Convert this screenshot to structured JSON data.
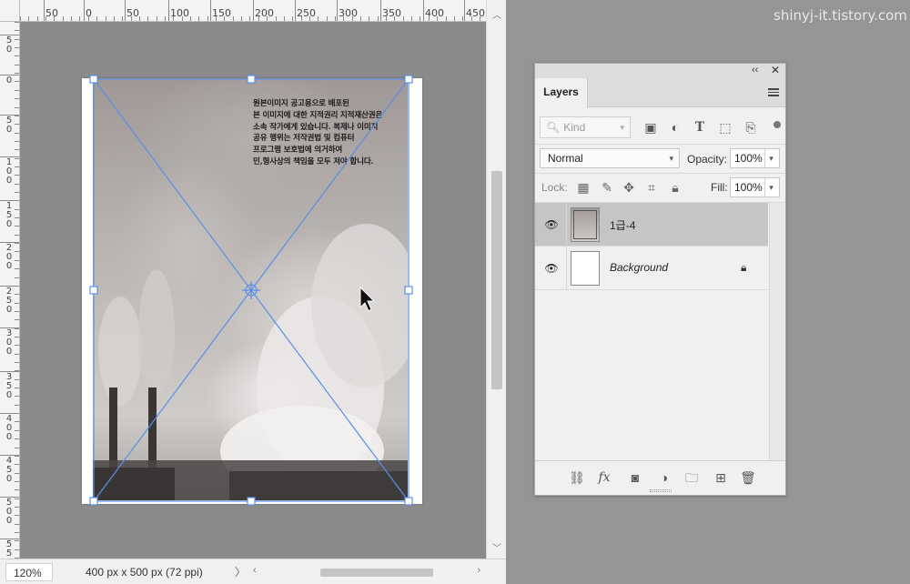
{
  "watermark": "shinyj-it.tistory.com",
  "rulers": {
    "horizontal": [
      "50",
      "0",
      "50",
      "100",
      "150",
      "200",
      "250",
      "300",
      "350",
      "400",
      "450"
    ],
    "vertical": [
      "5\n0",
      "0",
      "5\n0",
      "1\n0\n0",
      "1\n5\n0",
      "2\n0\n0",
      "2\n5\n0",
      "3\n0\n0",
      "3\n5\n0",
      "4\n0\n0",
      "4\n5\n0",
      "5\n0\n0",
      "5\n5\n0"
    ]
  },
  "status": {
    "zoom": "120%",
    "doc_info": "400 px x 500 px (72 ppi)",
    "info_arrow": "〉"
  },
  "image_caption": "원본이미지 공고용으로 배포된\n본 이미지에 대한 지적권리 지적재산권은\n소속 작가에게 있습니다. 복제나 이미지\n공유 행위는 저작권법 및 컴퓨터\n프로그램 보호법에 의거하여\n민,형사상의 책임을 모두 져야 합니다.",
  "layers_panel": {
    "collapse_icon": "‹‹",
    "close_icon": "✕",
    "tab_label": "Layers",
    "filter_kind": "Kind",
    "blend_mode": "Normal",
    "opacity_label": "Opacity:",
    "opacity_value": "100%",
    "lock_label": "Lock:",
    "fill_label": "Fill:",
    "fill_value": "100%",
    "layers": [
      {
        "name": "1급-4",
        "visible": true,
        "selected": true
      },
      {
        "name": "Background",
        "visible": true,
        "selected": false,
        "locked": true
      }
    ],
    "footer_icons": [
      "link-icon",
      "fx-icon",
      "mask-icon",
      "adjustment-icon",
      "folder-icon",
      "new-layer-icon",
      "trash-icon"
    ],
    "fx_label": "fx"
  },
  "colors": {
    "transform_line": "#5b8ee6",
    "selected_layer": "#c5c5c5",
    "workspace": "#959595"
  }
}
